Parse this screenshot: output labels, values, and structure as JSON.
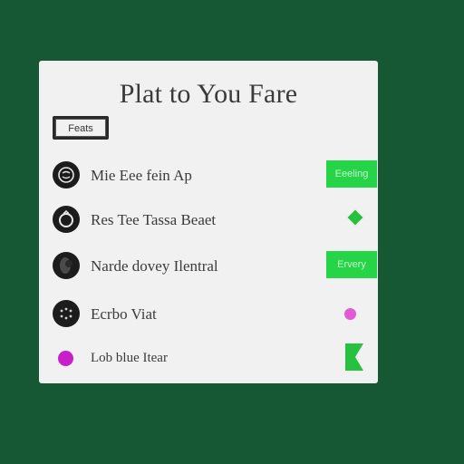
{
  "card": {
    "title": "Plat to You Fare",
    "chip_label": "Feats"
  },
  "rows": [
    {
      "label": "Mie Eee fein Ap",
      "action": "Eeeling",
      "trailing": "button"
    },
    {
      "label": "Res Tee Tassa Beaet",
      "action": "",
      "trailing": "diamond"
    },
    {
      "label": "Narde dovey Ilentral",
      "action": "Ervery",
      "trailing": "button"
    },
    {
      "label": "Ecrbo Viat",
      "action": "",
      "trailing": "dot"
    },
    {
      "label": "Lob blue Itear",
      "action": "",
      "trailing": "flag"
    }
  ],
  "colors": {
    "background": "#175834",
    "card": "#f1f1f1",
    "accent_green": "#26d447",
    "accent_pink": "#e15ad6",
    "avatar": "#1c1c1c"
  },
  "icons": {
    "avatar_1": "smiley-icon",
    "avatar_2": "ring-icon",
    "avatar_3": "person-icon",
    "avatar_4": "dots-icon",
    "row_5_dot": "magenta-dot-icon",
    "row_2_trailing": "diamond-icon",
    "row_4_trailing": "pink-dot-icon",
    "row_5_trailing": "flag-icon"
  }
}
